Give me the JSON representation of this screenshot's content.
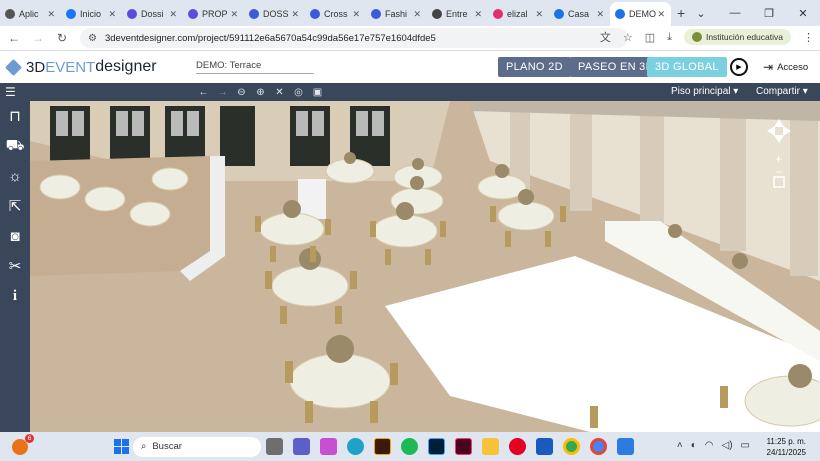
{
  "browser": {
    "tabs": [
      {
        "label": "Aplic",
        "icon": "globe-icon",
        "color": "#555555"
      },
      {
        "label": "Inicio",
        "icon": "facebook-icon",
        "color": "#1877f2"
      },
      {
        "label": "Dossi",
        "icon": "shield-icon",
        "color": "#5b4ddb"
      },
      {
        "label": "PROP",
        "icon": "shield-icon",
        "color": "#5b4ddb"
      },
      {
        "label": "DOSS",
        "icon": "chat-icon",
        "color": "#3b5bdb"
      },
      {
        "label": "Cross",
        "icon": "chat-icon",
        "color": "#3b5bdb"
      },
      {
        "label": "Fashi",
        "icon": "book-icon",
        "color": "#3b5bdb"
      },
      {
        "label": "Entre",
        "icon": "doc-icon",
        "color": "#444444"
      },
      {
        "label": "elizal",
        "icon": "instagram-icon",
        "color": "#e1306c"
      },
      {
        "label": "Casa",
        "icon": "window-icon",
        "color": "#1a73e8"
      },
      {
        "label": "DEMO",
        "icon": "window-icon",
        "color": "#1a73e8",
        "active": true
      }
    ],
    "url": "3deventdesigner.com/project/591112e6a5670a54c99da56e17e757e1604dfde5",
    "profile_label": "Institución educativa"
  },
  "app": {
    "logo_prefix": "3D",
    "logo_light": "EVENT",
    "logo_suffix": "designer",
    "project_name": "DEMO: Terrace",
    "view_buttons": [
      {
        "label": "PLANO 2D",
        "active": false
      },
      {
        "label": "PASEO EN 3D",
        "active": false
      },
      {
        "label": "3D GLOBAL",
        "active": true
      }
    ],
    "login_label": "Acceso",
    "floor_dropdown": "Piso principal",
    "share_dropdown": "Compartir",
    "accent": "#7bd0e0",
    "button_color": "#5b6d8a",
    "toolbar_color": "#3a4659"
  },
  "sidebar_icons": [
    "furniture-icon",
    "sofa-icon",
    "light-icon",
    "export-icon",
    "camera-icon",
    "tools-icon",
    "info-icon"
  ],
  "taskbar": {
    "search_placeholder": "Buscar",
    "time": "11:25 p. m.",
    "date": "24/11/2025",
    "notification_count": "6"
  }
}
